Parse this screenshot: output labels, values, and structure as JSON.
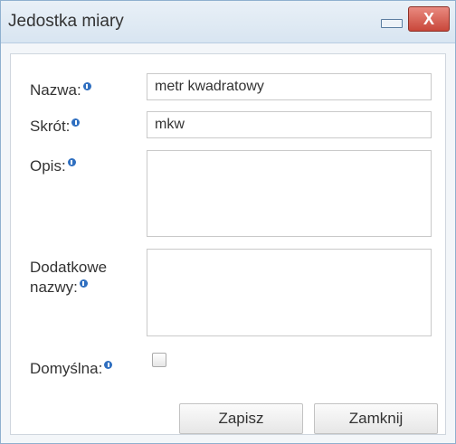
{
  "window": {
    "title": "Jedostka miary",
    "close_glyph": "X"
  },
  "form": {
    "nazwa": {
      "label": "Nazwa:",
      "value": "metr kwadratowy"
    },
    "skrot": {
      "label": "Skrót:",
      "value": "mkw"
    },
    "opis": {
      "label": "Opis:",
      "value": ""
    },
    "dodatkowe_nazwy": {
      "label": "Dodatkowe\nnazwy:",
      "value": ""
    },
    "domyslna": {
      "label": "Domyślna:",
      "checked": false
    }
  },
  "buttons": {
    "save": "Zapisz",
    "close": "Zamknij"
  },
  "colors": {
    "info_icon": "#2f6fc0",
    "close_button": "#c9473a"
  }
}
